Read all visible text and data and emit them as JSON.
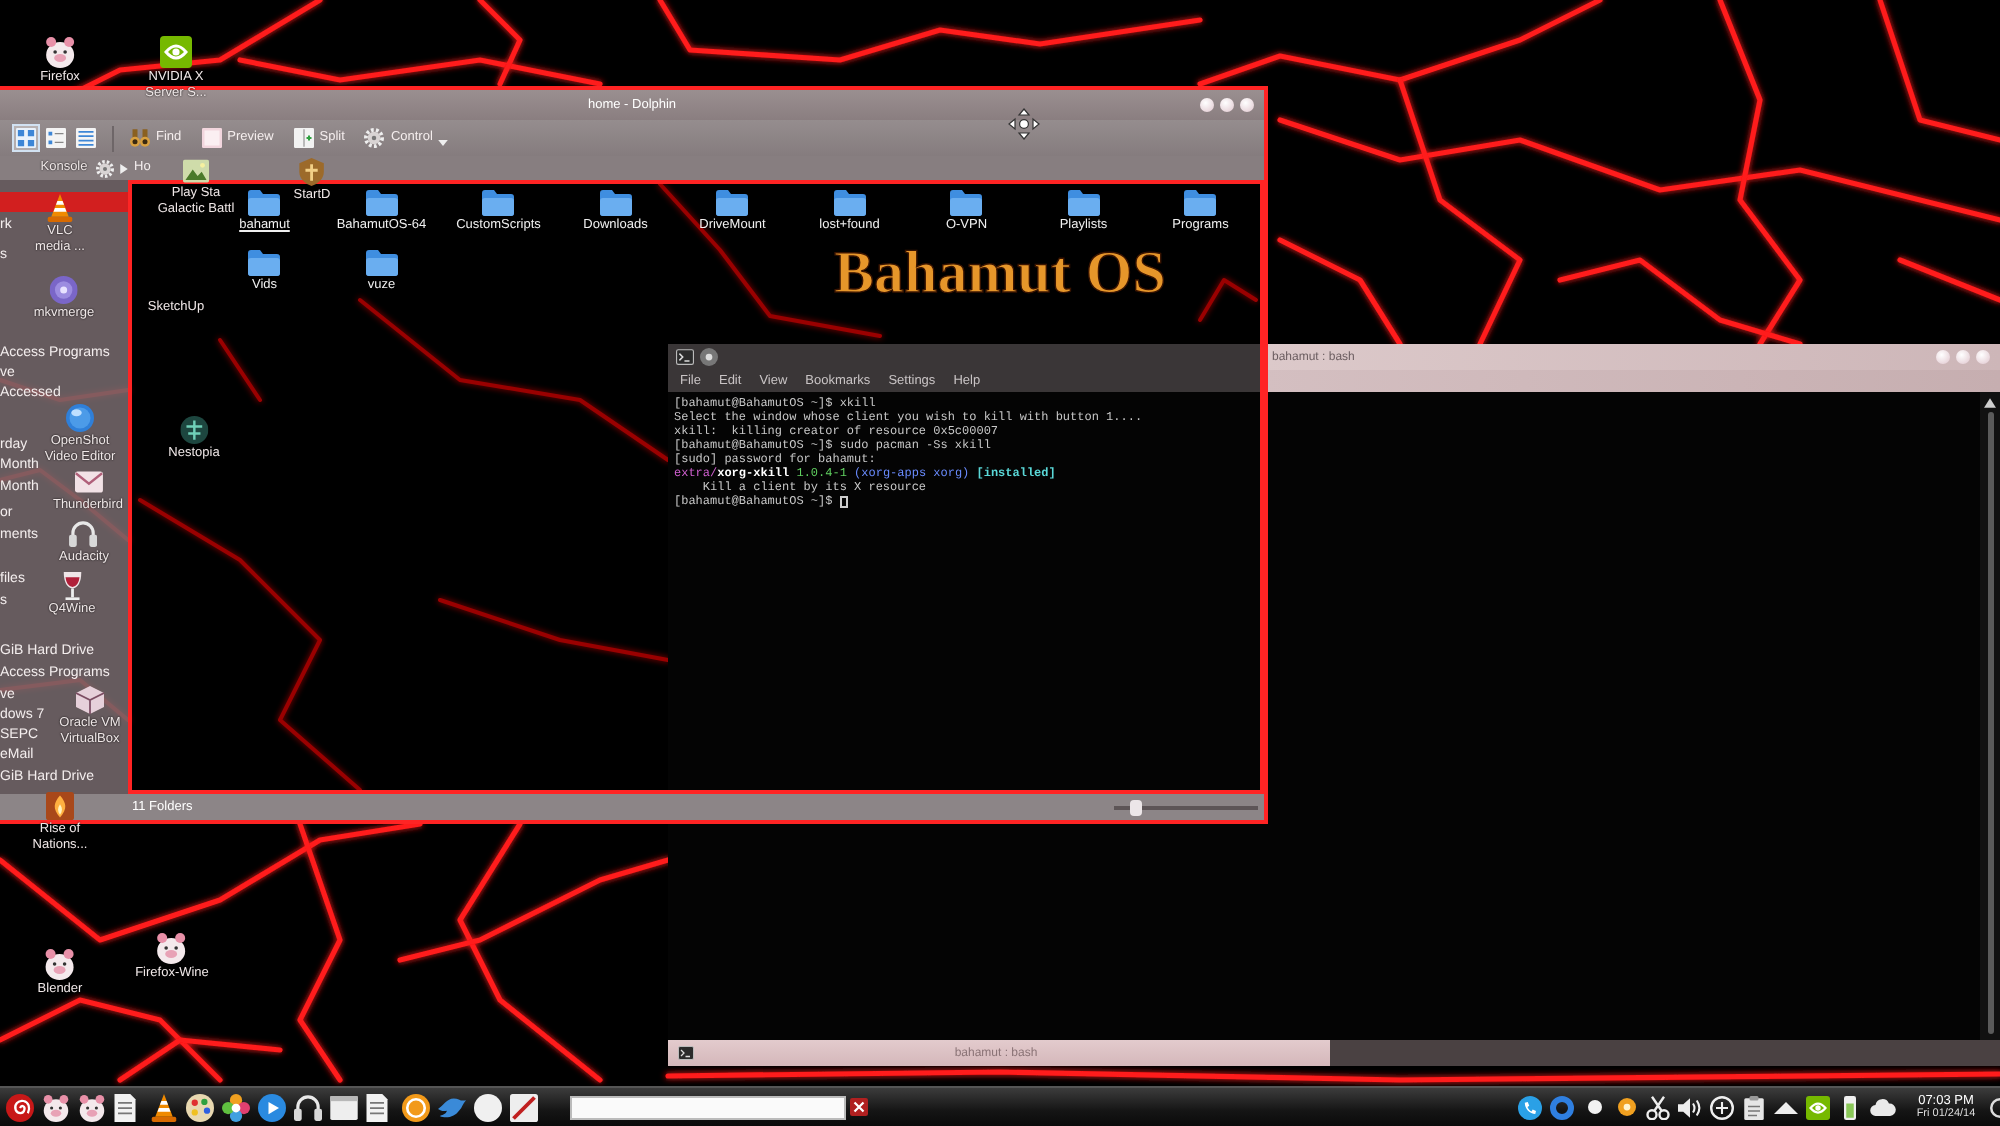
{
  "wallpaper": {
    "logo_text": "Bahamut OS"
  },
  "file_manager": {
    "title": "home - Dolphin",
    "view_modes": [
      {
        "kind": "icons",
        "selected": true
      },
      {
        "kind": "compact",
        "selected": false
      },
      {
        "kind": "details",
        "selected": false
      }
    ],
    "toolbar": [
      {
        "kind": "find",
        "label": "Find"
      },
      {
        "kind": "preview",
        "label": "Preview"
      },
      {
        "kind": "split",
        "label": "Split"
      },
      {
        "kind": "control",
        "label": "Control"
      }
    ],
    "location": "Ho",
    "places": [
      {
        "selected": true
      },
      {
        "label": "rk",
        "selected": false
      },
      {
        "label": "s",
        "selected": false
      },
      {
        "label": "Access Programs",
        "selected": false
      },
      {
        "label": "ve",
        "selected": false
      },
      {
        "label": "Accessed",
        "selected": false
      },
      {
        "label": "rday",
        "selected": false
      },
      {
        "label": "Month",
        "selected": false
      },
      {
        "label": "Month",
        "selected": false
      },
      {
        "label": "or",
        "selected": false
      },
      {
        "label": "ments",
        "selected": false
      },
      {
        "label": "files",
        "selected": false
      },
      {
        "label": "s",
        "selected": false
      },
      {
        "label": "GiB Hard Drive",
        "selected": false
      },
      {
        "label": "Access Programs",
        "selected": false
      },
      {
        "label": "ve",
        "selected": false
      },
      {
        "label": "dows 7",
        "selected": false
      },
      {
        "label": "SEPC",
        "selected": false
      },
      {
        "label": "eMail",
        "selected": false
      },
      {
        "label": "GiB Hard Drive",
        "selected": false
      }
    ],
    "folders": [
      {
        "name": "bahamut",
        "hovered": true
      },
      {
        "name": "BahamutOS-64",
        "hovered": false
      },
      {
        "name": "CustomScripts",
        "hovered": false
      },
      {
        "name": "Downloads",
        "hovered": false
      },
      {
        "name": "DriveMount",
        "hovered": false
      },
      {
        "name": "lost+found",
        "hovered": false
      },
      {
        "name": "O-VPN",
        "hovered": false
      },
      {
        "name": "Playlists",
        "hovered": false
      },
      {
        "name": "Programs",
        "hovered": false
      },
      {
        "name": "Vids",
        "hovered": false
      },
      {
        "name": "vuze",
        "hovered": false
      }
    ],
    "status": "11 Folders",
    "zoom_slider": {
      "level": 0.12
    }
  },
  "terminal": {
    "title": "bahamut : bash",
    "menu": [
      "File",
      "Edit",
      "View",
      "Bookmarks",
      "Settings",
      "Help"
    ],
    "lines": [
      {
        "segments": [
          {
            "kind": "plain",
            "text": "[bahamut@BahamutOS ~]$ xkill"
          }
        ],
        "cursor": false
      },
      {
        "segments": [
          {
            "kind": "plain",
            "text": "Select the window whose client you wish to kill with button 1...."
          }
        ],
        "cursor": false
      },
      {
        "segments": [
          {
            "kind": "plain",
            "text": "xkill:  killing creator of resource 0x5c00007"
          }
        ],
        "cursor": false
      },
      {
        "segments": [
          {
            "kind": "plain",
            "text": "[bahamut@BahamutOS ~]$ sudo pacman -Ss xkill"
          }
        ],
        "cursor": false
      },
      {
        "segments": [
          {
            "kind": "plain",
            "text": "[sudo] password for bahamut:"
          }
        ],
        "cursor": false
      },
      {
        "segments": [
          {
            "kind": "repo",
            "text": "extra/"
          },
          {
            "kind": "package",
            "text": "xorg-xkill"
          },
          {
            "kind": "version",
            "text": " 1.0.4-1"
          },
          {
            "kind": "group",
            "text": " (xorg-apps xorg)"
          },
          {
            "kind": "installed",
            "text": " [installed]"
          }
        ],
        "cursor": false
      },
      {
        "segments": [
          {
            "kind": "plain",
            "text": "    Kill a client by its X resource"
          }
        ],
        "cursor": false
      },
      {
        "segments": [
          {
            "kind": "plain",
            "text": "[bahamut@BahamutOS ~]$ "
          }
        ],
        "cursor": true
      }
    ],
    "tab": "bahamut : bash"
  },
  "desktop_icons": [
    {
      "label": "Firefox",
      "kind": "pig"
    },
    {
      "label": "NVIDIA X Server S...",
      "kind": "chip"
    },
    {
      "label": "Konsole"
    },
    {
      "label": "Play Sta Galactic Battl",
      "kind": "picture"
    },
    {
      "label": "StartD",
      "kind": "shield"
    },
    {
      "label": "VLC media ...",
      "kind": "cone"
    },
    {
      "label": "mkvmerge",
      "kind": "disc"
    },
    {
      "label": "OpenShot Video Editor",
      "kind": "globe"
    },
    {
      "label": "Thunderbird",
      "kind": "envelope"
    },
    {
      "label": "Audacity",
      "kind": "headphones"
    },
    {
      "label": "Q4Wine",
      "kind": "wineglass"
    },
    {
      "label": "Oracle VM VirtualBox",
      "kind": "cube"
    },
    {
      "label": "Rise of Nations...",
      "kind": "flame"
    },
    {
      "label": "SketchUp"
    },
    {
      "label": "Nestopia",
      "kind": "emblem"
    },
    {
      "label": "Blender",
      "kind": "pig"
    },
    {
      "label": "Firefox-Wine",
      "kind": "pig"
    }
  ],
  "taskbar": {
    "launchers": [
      {
        "kind": "spiral"
      },
      {
        "kind": "pig"
      },
      {
        "kind": "pig"
      },
      {
        "kind": "document"
      },
      {
        "kind": "cone"
      },
      {
        "kind": "palette"
      },
      {
        "kind": "flower"
      },
      {
        "kind": "play"
      },
      {
        "kind": "headphones"
      },
      {
        "kind": "window"
      },
      {
        "kind": "document"
      },
      {
        "kind": "coin"
      },
      {
        "kind": "bird"
      },
      {
        "kind": "circle"
      },
      {
        "kind": "slash"
      }
    ],
    "tray": [
      {
        "kind": "phone"
      },
      {
        "kind": "ring"
      },
      {
        "kind": "dot"
      },
      {
        "kind": "target"
      },
      {
        "kind": "scissors"
      },
      {
        "kind": "speaker"
      },
      {
        "kind": "network"
      },
      {
        "kind": "clipboard"
      },
      {
        "kind": "expand"
      },
      {
        "kind": "chip"
      },
      {
        "kind": "battery"
      },
      {
        "kind": "cloud"
      }
    ],
    "clock": {
      "time": "07:03 PM",
      "date": "Fri 01/24/14"
    }
  }
}
